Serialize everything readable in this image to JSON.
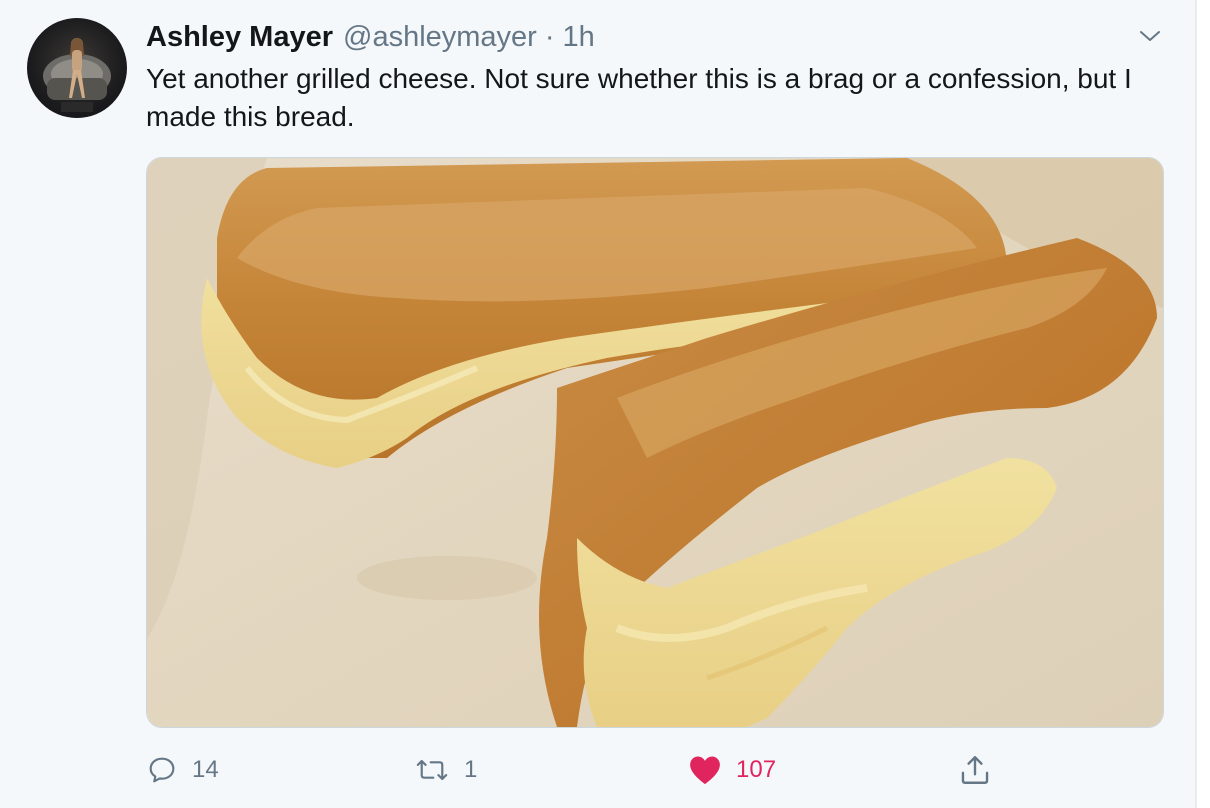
{
  "tweet": {
    "author_name": "Ashley Mayer",
    "handle": "@ashleymayer",
    "separator": "·",
    "time": "1h",
    "text": "Yet another grilled cheese. Not sure whether this is a brag or a confession, but I made this bread.",
    "media_icon": "grilled-cheese-photo",
    "avatar_icon": "profile-photo"
  },
  "actions": {
    "reply_count": "14",
    "retweet_count": "1",
    "like_count": "107",
    "liked": true
  },
  "colors": {
    "text": "#14171a",
    "secondary": "#657786",
    "like": "#e0245e",
    "background": "#f5f8fa"
  }
}
